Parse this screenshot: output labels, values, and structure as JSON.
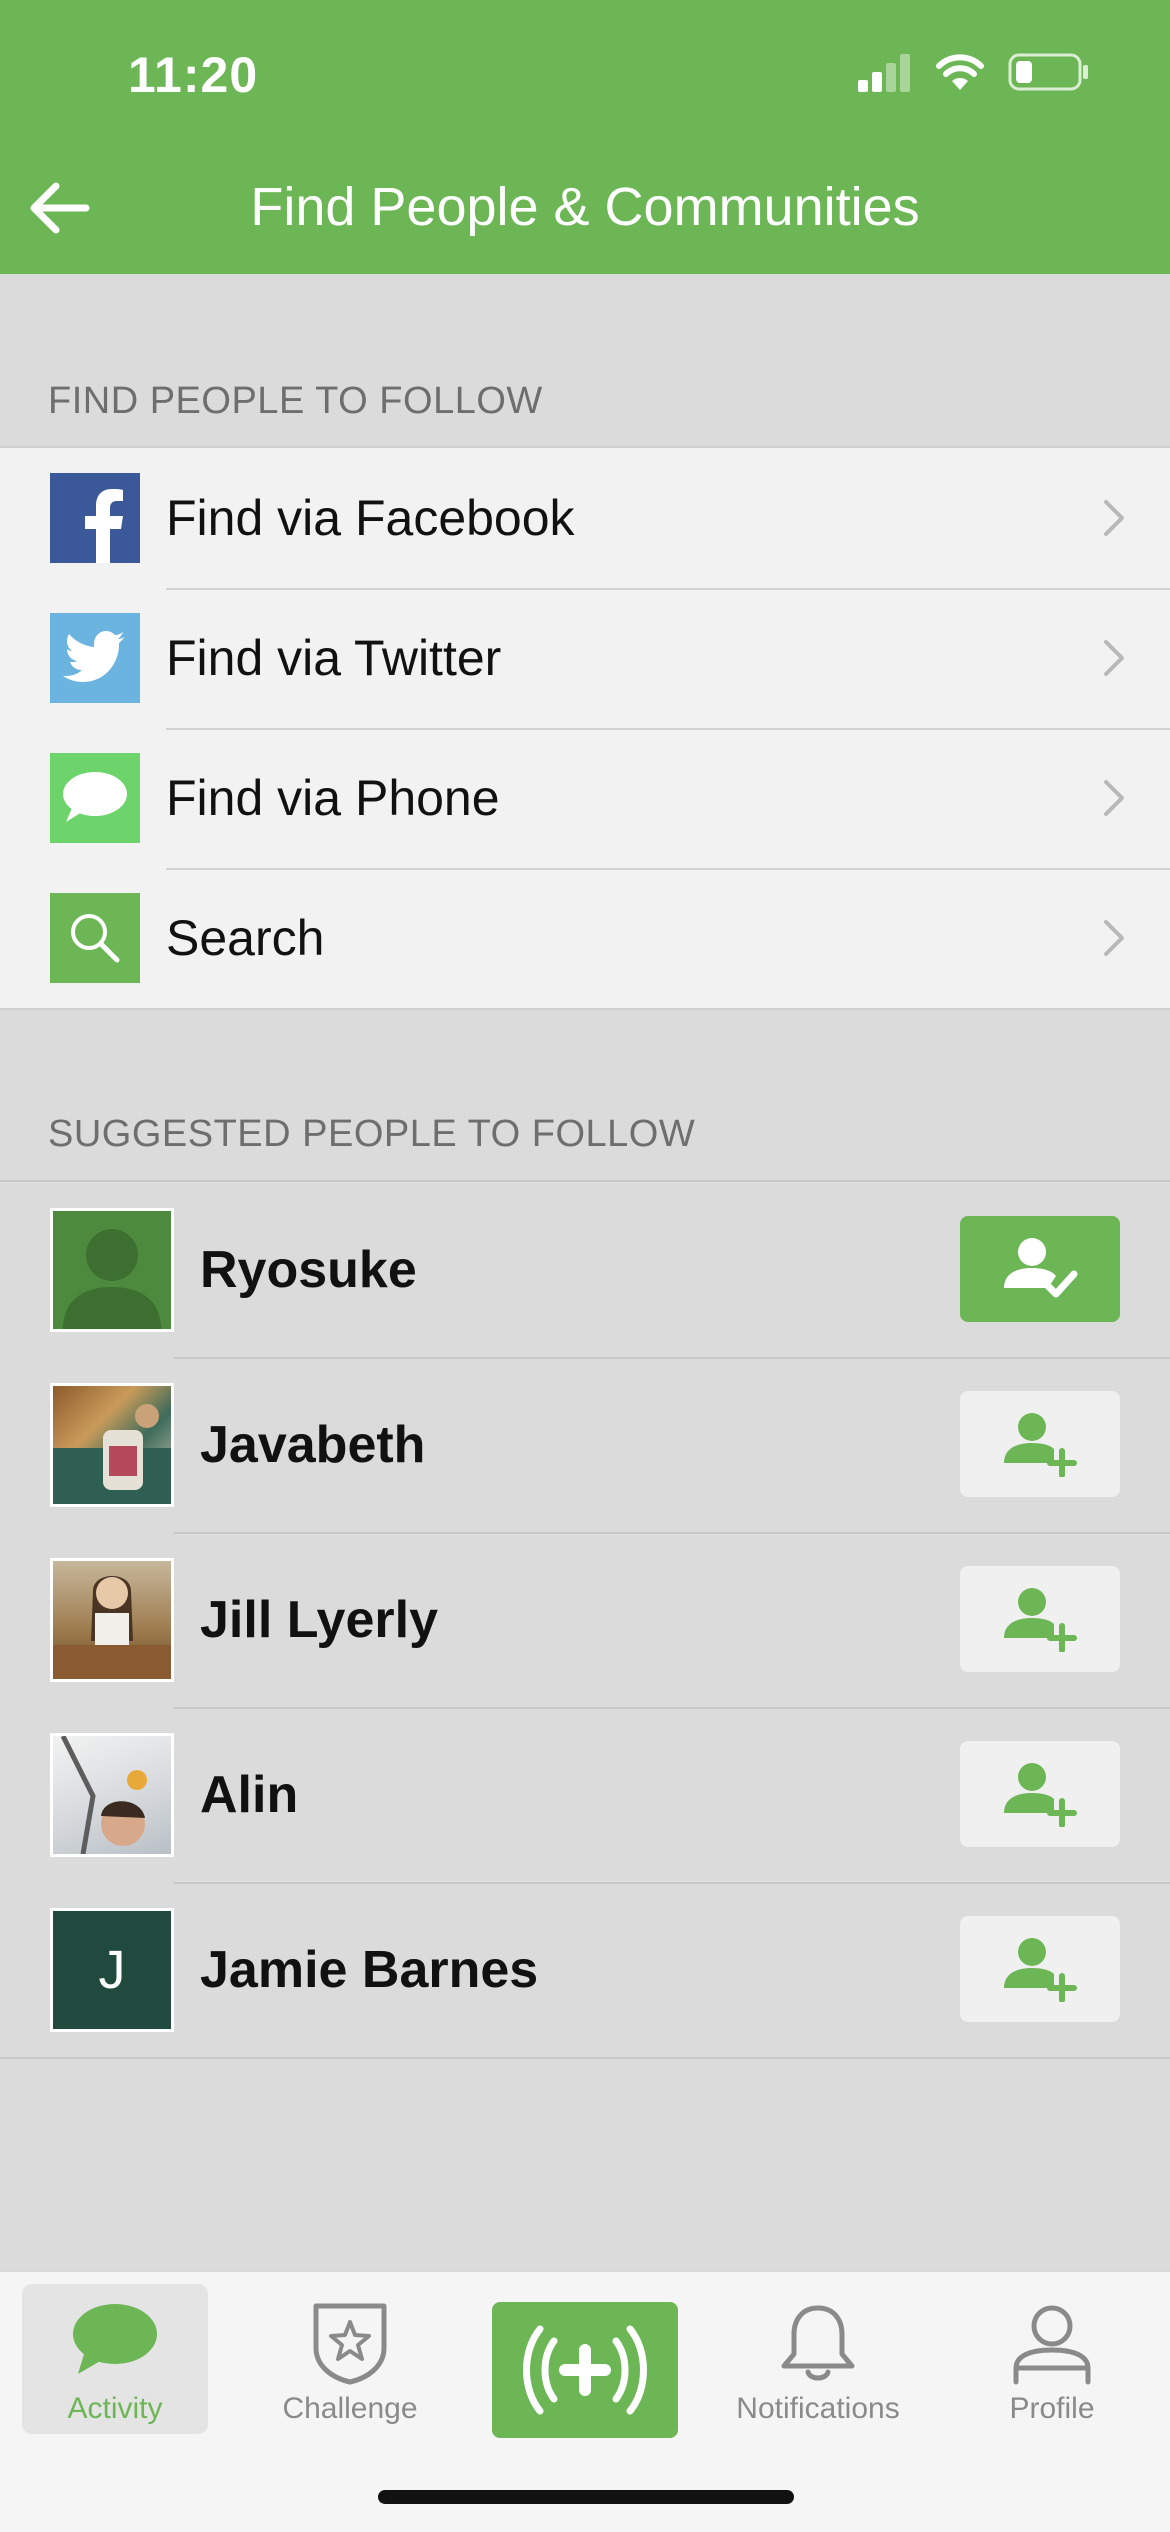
{
  "status": {
    "time": "11:20"
  },
  "nav": {
    "title": "Find People & Communities"
  },
  "find_section": {
    "header": "FIND PEOPLE TO FOLLOW",
    "items": [
      {
        "label": "Find via Facebook",
        "icon": "facebook-icon",
        "color": "#3b5998"
      },
      {
        "label": "Find via Twitter",
        "icon": "twitter-icon",
        "color": "#6cb4e0"
      },
      {
        "label": "Find via Phone",
        "icon": "message-icon",
        "color": "#6cd46a"
      },
      {
        "label": "Search",
        "icon": "search-icon",
        "color": "#6db655"
      }
    ]
  },
  "suggest_section": {
    "header": "SUGGESTED PEOPLE TO FOLLOW",
    "people": [
      {
        "name": "Ryosuke",
        "following": true,
        "avatar": "placeholder"
      },
      {
        "name": "Javabeth",
        "following": false,
        "avatar": "photo"
      },
      {
        "name": "Jill Lyerly",
        "following": false,
        "avatar": "photo"
      },
      {
        "name": "Alin",
        "following": false,
        "avatar": "photo"
      },
      {
        "name": "Jamie Barnes",
        "following": false,
        "avatar": "initial",
        "initial": "J"
      }
    ]
  },
  "tabbar": {
    "tabs": [
      {
        "label": "Activity",
        "active": true
      },
      {
        "label": "Challenge",
        "active": false
      },
      {
        "label": "Notifications",
        "active": false
      },
      {
        "label": "Profile",
        "active": false
      }
    ]
  },
  "colors": {
    "brand": "#6db655",
    "background": "#dbdbdb"
  }
}
